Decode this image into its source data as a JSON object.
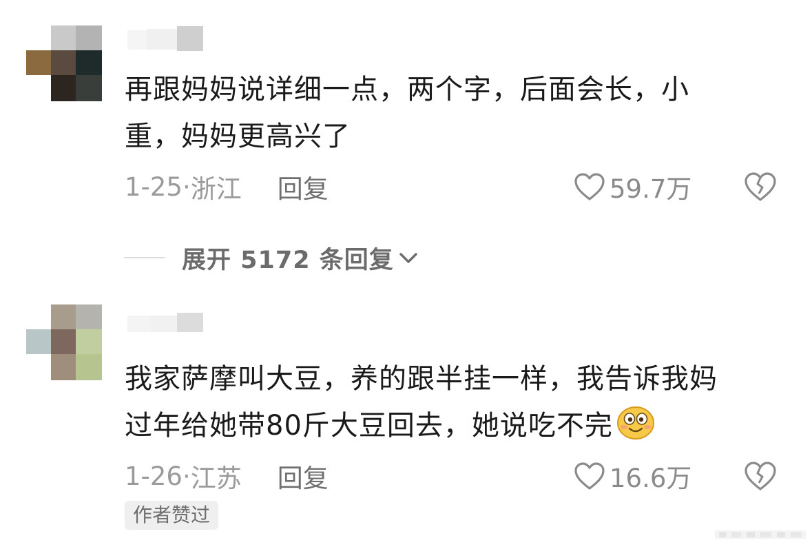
{
  "comments": [
    {
      "text_line1": "再跟妈妈说详细一点，两个字，后面会长，小",
      "text_line2": "重，妈妈更高兴了",
      "date": "1-25",
      "location": "浙江",
      "reply_label": "回复",
      "likes": "59.7万",
      "expand_label": "展开 5172 条回复"
    },
    {
      "text_line1": "我家萨摩叫大豆，养的跟半挂一样，我告诉我妈",
      "text_line2": "过年给她带80斤大豆回去，她说吃不完",
      "emoji": "smiley-emoji",
      "date": "1-26",
      "location": "江苏",
      "reply_label": "回复",
      "likes": "16.6万",
      "badge": "作者赞过"
    }
  ],
  "separator": "·",
  "icons": {
    "like": "heart-outline-icon",
    "dislike": "broken-heart-icon",
    "expand": "chevron-down-icon"
  },
  "colors": {
    "text": "#1a1a1a",
    "meta": "#9a9a9a",
    "reply": "#6f6f6f",
    "badge_bg": "#efefef"
  }
}
